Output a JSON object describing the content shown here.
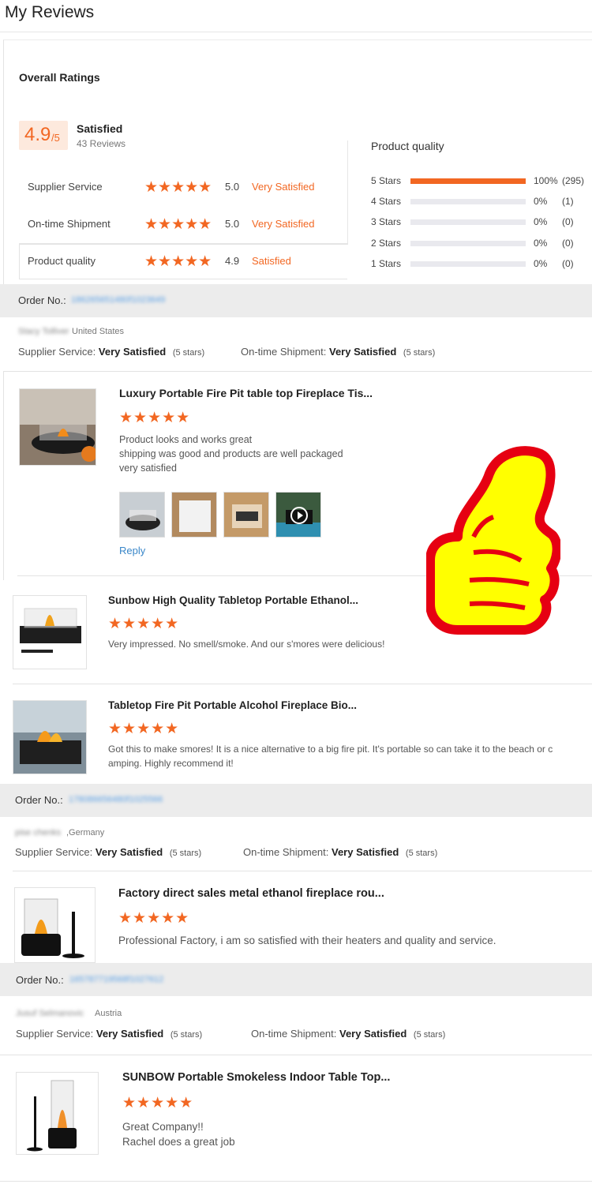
{
  "page": {
    "title": "My Reviews"
  },
  "overall": {
    "title": "Overall Ratings",
    "score": "4.9",
    "score_suffix": "/5",
    "label": "Satisfied",
    "count": "43 Reviews",
    "categories": [
      {
        "name": "Supplier Service",
        "stars": "★★★★★",
        "score": "5.0",
        "verdict": "Very Satisfied"
      },
      {
        "name": "On-time Shipment",
        "stars": "★★★★★",
        "score": "5.0",
        "verdict": "Very Satisfied"
      },
      {
        "name": "Product quality",
        "stars": "★★★★★",
        "score": "4.9",
        "verdict": "Satisfied"
      }
    ]
  },
  "product_quality": {
    "title": "Product quality",
    "rows": [
      {
        "label": "5 Stars",
        "fraction": 1.0,
        "pct": "100%",
        "count": "(295)"
      },
      {
        "label": "4 Stars",
        "fraction": 0,
        "pct": "0%",
        "count": "(1)"
      },
      {
        "label": "3 Stars",
        "fraction": 0,
        "pct": "0%",
        "count": "(0)"
      },
      {
        "label": "2 Stars",
        "fraction": 0,
        "pct": "0%",
        "count": "(0)"
      },
      {
        "label": "1 Stars",
        "fraction": 0,
        "pct": "0%",
        "count": "(0)"
      }
    ]
  },
  "orders": [
    {
      "order_label": "Order No.:",
      "order_number": "186265651480f1023649",
      "reviewer": "Stacy Tolliver",
      "country": "United States",
      "supplier_label": "Supplier Service:",
      "supplier_value": "Very Satisfied",
      "supplier_stars": "(5 stars)",
      "shipment_label": "On-time Shipment:",
      "shipment_value": "Very Satisfied",
      "shipment_stars": "(5 stars)",
      "products": [
        {
          "title": "Luxury Portable Fire Pit table top Fireplace Tis...",
          "stars": "★★★★★",
          "review_lines": [
            "Product looks and works great",
            "shipping was good and products are well packaged",
            "very satisfied"
          ],
          "reply": "Reply"
        },
        {
          "title": "Sunbow High Quality Tabletop Portable Ethanol...",
          "stars": "★★★★★",
          "review_lines": [
            "Very impressed. No smell/smoke. And our s'mores were delicious!"
          ]
        },
        {
          "title": "Tabletop Fire Pit Portable Alcohol Fireplace Bio...",
          "stars": "★★★★★",
          "review_lines": [
            "Got this to make smores! It is a nice alternative to a big fire pit. It's portable so can take it to the beach or c",
            "amping. Highly recommend it!"
          ]
        }
      ]
    },
    {
      "order_label": "Order No.:",
      "order_number": "178086656480f1025566",
      "reviewer": "pise chenks",
      "country": ",Germany",
      "supplier_label": "Supplier Service:",
      "supplier_value": "Very Satisfied",
      "supplier_stars": "(5 stars)",
      "shipment_label": "On-time Shipment:",
      "shipment_value": "Very Satisfied",
      "shipment_stars": "(5 stars)",
      "products": [
        {
          "title": "Factory direct sales metal ethanol fireplace rou...",
          "stars": "★★★★★",
          "review_lines": [
            "Professional Factory, i am so satisfied with their heaters and quality and service."
          ]
        }
      ]
    },
    {
      "order_label": "Order No.:",
      "order_number": "165787719568f1027612",
      "reviewer": "Jusuf Selmanovic",
      "country": "Austria",
      "supplier_label": "Supplier Service:",
      "supplier_value": "Very Satisfied",
      "supplier_stars": "(5 stars)",
      "shipment_label": "On-time Shipment:",
      "shipment_value": "Very Satisfied",
      "shipment_stars": "(5 stars)",
      "products": [
        {
          "title": "SUNBOW Portable Smokeless Indoor Table Top...",
          "stars": "★★★★★",
          "review_lines": [
            "Great Company!!",
            "Rachel does a great job"
          ]
        }
      ]
    }
  ],
  "colors": {
    "accent": "#f26722",
    "link": "#3a87c9",
    "order_bar": "#ececec",
    "thumbs_fill": "#ffff00",
    "thumbs_outline": "#e60012"
  },
  "icons": {
    "play": "play-icon",
    "thumbs_up": "thumbs-up-icon"
  }
}
